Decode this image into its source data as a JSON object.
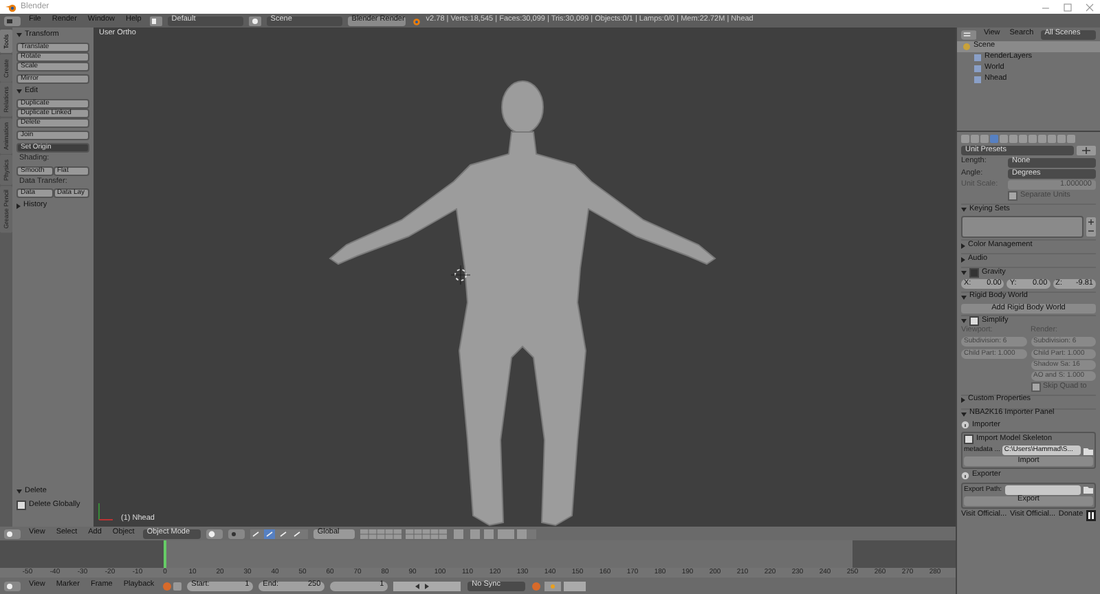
{
  "title_bar": {
    "title": "Blender"
  },
  "info_header": {
    "menus": [
      "File",
      "Render",
      "Window",
      "Help"
    ],
    "screen_layout": "Default",
    "scene": "Scene",
    "render_engine": "Blender Render",
    "stats": "v2.78 | Verts:18,545 | Faces:30,099 | Tris:30,099 | Objects:0/1 | Lamps:0/0 | Mem:22.72M | Nhead"
  },
  "tool_tabs": [
    {
      "label": "Tools",
      "selected": true
    },
    {
      "label": "Create",
      "selected": false
    },
    {
      "label": "Relations",
      "selected": false
    },
    {
      "label": "Animation",
      "selected": false
    },
    {
      "label": "Physics",
      "selected": false
    },
    {
      "label": "Grease Pencil",
      "selected": false
    }
  ],
  "tool_shelf": [
    {
      "title": "Transform",
      "expanded": true,
      "rows": [
        {
          "kind": "group",
          "buttons": [
            "Translate",
            "Rotate",
            "Scale"
          ]
        },
        {
          "kind": "group",
          "buttons": [
            "Mirror"
          ]
        }
      ]
    },
    {
      "title": "Edit",
      "expanded": true,
      "rows": [
        {
          "kind": "group",
          "buttons": [
            "Duplicate",
            "Duplicate Linked",
            "Delete"
          ]
        },
        {
          "kind": "group",
          "buttons": [
            "Join"
          ]
        },
        {
          "kind": "dropdown",
          "buttons": [
            "Set Origin"
          ]
        },
        {
          "kind": "label",
          "buttons": [
            "Shading:"
          ]
        },
        {
          "kind": "pair",
          "buttons": [
            "Smooth",
            "Flat"
          ]
        },
        {
          "kind": "label",
          "buttons": [
            "Data Transfer:"
          ]
        },
        {
          "kind": "pair",
          "buttons": [
            "Data",
            "Data Lay"
          ]
        }
      ]
    },
    {
      "title": "History",
      "expanded": false
    }
  ],
  "delete_panel": {
    "title": "Delete",
    "checkbox": {
      "label": "Delete Globally",
      "checked": false
    }
  },
  "viewport": {
    "view_label": "User Ortho",
    "object_label": "(1) Nhead"
  },
  "viewport_header": {
    "menus": [
      "View",
      "Select",
      "Add",
      "Object"
    ],
    "mode": "Object Mode",
    "orientation": "Global"
  },
  "timeline": {
    "ticks": [
      "-50",
      "-40",
      "-30",
      "-20",
      "-10",
      "0",
      "10",
      "20",
      "30",
      "40",
      "50",
      "60",
      "70",
      "80",
      "90",
      "100",
      "110",
      "120",
      "130",
      "140",
      "150",
      "160",
      "170",
      "180",
      "190",
      "200",
      "210",
      "220",
      "230",
      "240",
      "250",
      "260",
      "270",
      "280"
    ]
  },
  "timeline_header": {
    "menus": [
      "View",
      "Marker",
      "Frame",
      "Playback"
    ],
    "start_label": "Start:",
    "start": "1",
    "end_label": "End:",
    "end": "250",
    "current_frame": "1",
    "sync": "No Sync"
  },
  "outliner": {
    "view": "View",
    "search": "Search",
    "filter": "All Scenes",
    "tree": [
      {
        "label": "Scene",
        "children": [
          {
            "label": "RenderLayers"
          },
          {
            "label": "World"
          },
          {
            "label": "Nhead"
          }
        ]
      }
    ]
  },
  "property_tabs": [
    {
      "selected": false
    },
    {
      "selected": false
    },
    {
      "selected": false
    },
    {
      "selected": true
    },
    {
      "selected": false
    },
    {
      "selected": false
    },
    {
      "selected": false
    },
    {
      "selected": false
    },
    {
      "selected": false
    },
    {
      "selected": false
    },
    {
      "selected": false
    },
    {
      "selected": false
    }
  ],
  "units": {
    "preset": "Unit Presets",
    "length_label": "Length:",
    "length": "None",
    "angle_label": "Angle:",
    "angle": "Degrees",
    "scale_label": "Unit Scale:",
    "scale": "1.000000",
    "separate_units": "Separate Units",
    "separate_checked": false,
    "disabled": true
  },
  "panels": [
    {
      "kind": "keying_sets",
      "title": "Keying Sets",
      "expanded": true
    },
    {
      "kind": "plain",
      "title": "Color Management",
      "expanded": false
    },
    {
      "kind": "plain",
      "title": "Audio",
      "expanded": false
    },
    {
      "kind": "gravity",
      "title": "Gravity",
      "expanded": true,
      "checked": true,
      "fields": [
        {
          "label": "X:",
          "value": "0.00"
        },
        {
          "label": "Y:",
          "value": "0.00"
        },
        {
          "label": "Z:",
          "value": "-9.81"
        }
      ]
    },
    {
      "kind": "button",
      "title": "Rigid Body World",
      "expanded": true,
      "button": "Add Rigid Body World"
    },
    {
      "kind": "simplify",
      "title": "Simplify",
      "expanded": true,
      "checked": false,
      "columns": [
        {
          "label": "Viewport:",
          "fields": [
            "Subdivision: 6",
            "Child Part: 1.000"
          ]
        },
        {
          "label": "Render:",
          "fields": [
            "Subdivision: 6",
            "Child Part: 1.000",
            "Shadow Sa: 16",
            "AO and S: 1.000"
          ]
        }
      ],
      "skip": "Skip Quad to",
      "skip_checked": false
    },
    {
      "kind": "plain",
      "title": "Custom Properties",
      "expanded": false
    },
    {
      "kind": "importer",
      "title": "NBA2K16 Importer Panel",
      "expanded": true,
      "importer_label": "Importer",
      "skeleton": {
        "label": "Import Model Skeleton",
        "checked": false
      },
      "metadata_label": "metadata ...",
      "path": "C:\\Users\\Hammad\\S...",
      "import_button": "Import",
      "exporter_label": "Exporter",
      "export_path_label": "Export Path:",
      "export_button": "Export",
      "links": [
        "Visit Official...",
        "Visit Official...",
        "Donate"
      ]
    }
  ]
}
